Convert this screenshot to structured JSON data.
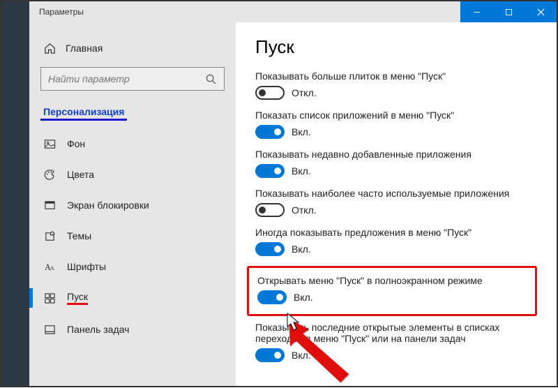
{
  "window": {
    "title": "Параметры"
  },
  "sidebar": {
    "home": "Главная",
    "search_placeholder": "Найти параметр",
    "category": "Персонализация",
    "items": [
      {
        "label": "Фон"
      },
      {
        "label": "Цвета"
      },
      {
        "label": "Экран блокировки"
      },
      {
        "label": "Темы"
      },
      {
        "label": "Шрифты"
      },
      {
        "label": "Пуск"
      },
      {
        "label": "Панель задач"
      }
    ]
  },
  "main": {
    "title": "Пуск",
    "settings": [
      {
        "label": "Показывать больше плиток в меню \"Пуск\"",
        "on": false,
        "state": "Откл."
      },
      {
        "label": "Показать список приложений в меню \"Пуск\"",
        "on": true,
        "state": "Вкл."
      },
      {
        "label": "Показывать недавно добавленные приложения",
        "on": true,
        "state": "Вкл."
      },
      {
        "label": "Показывать наиболее часто используемые приложения",
        "on": false,
        "state": "Откл."
      },
      {
        "label": "Иногда показывать предложения в меню \"Пуск\"",
        "on": true,
        "state": "Вкл."
      },
      {
        "label": "Открывать меню \"Пуск\" в полноэкранном режиме",
        "on": true,
        "state": "Вкл."
      },
      {
        "label": "Показывать последние открытые элементы в списках переходов в меню \"Пуск\" или на панели задач",
        "on": true,
        "state": "Вкл."
      }
    ]
  }
}
